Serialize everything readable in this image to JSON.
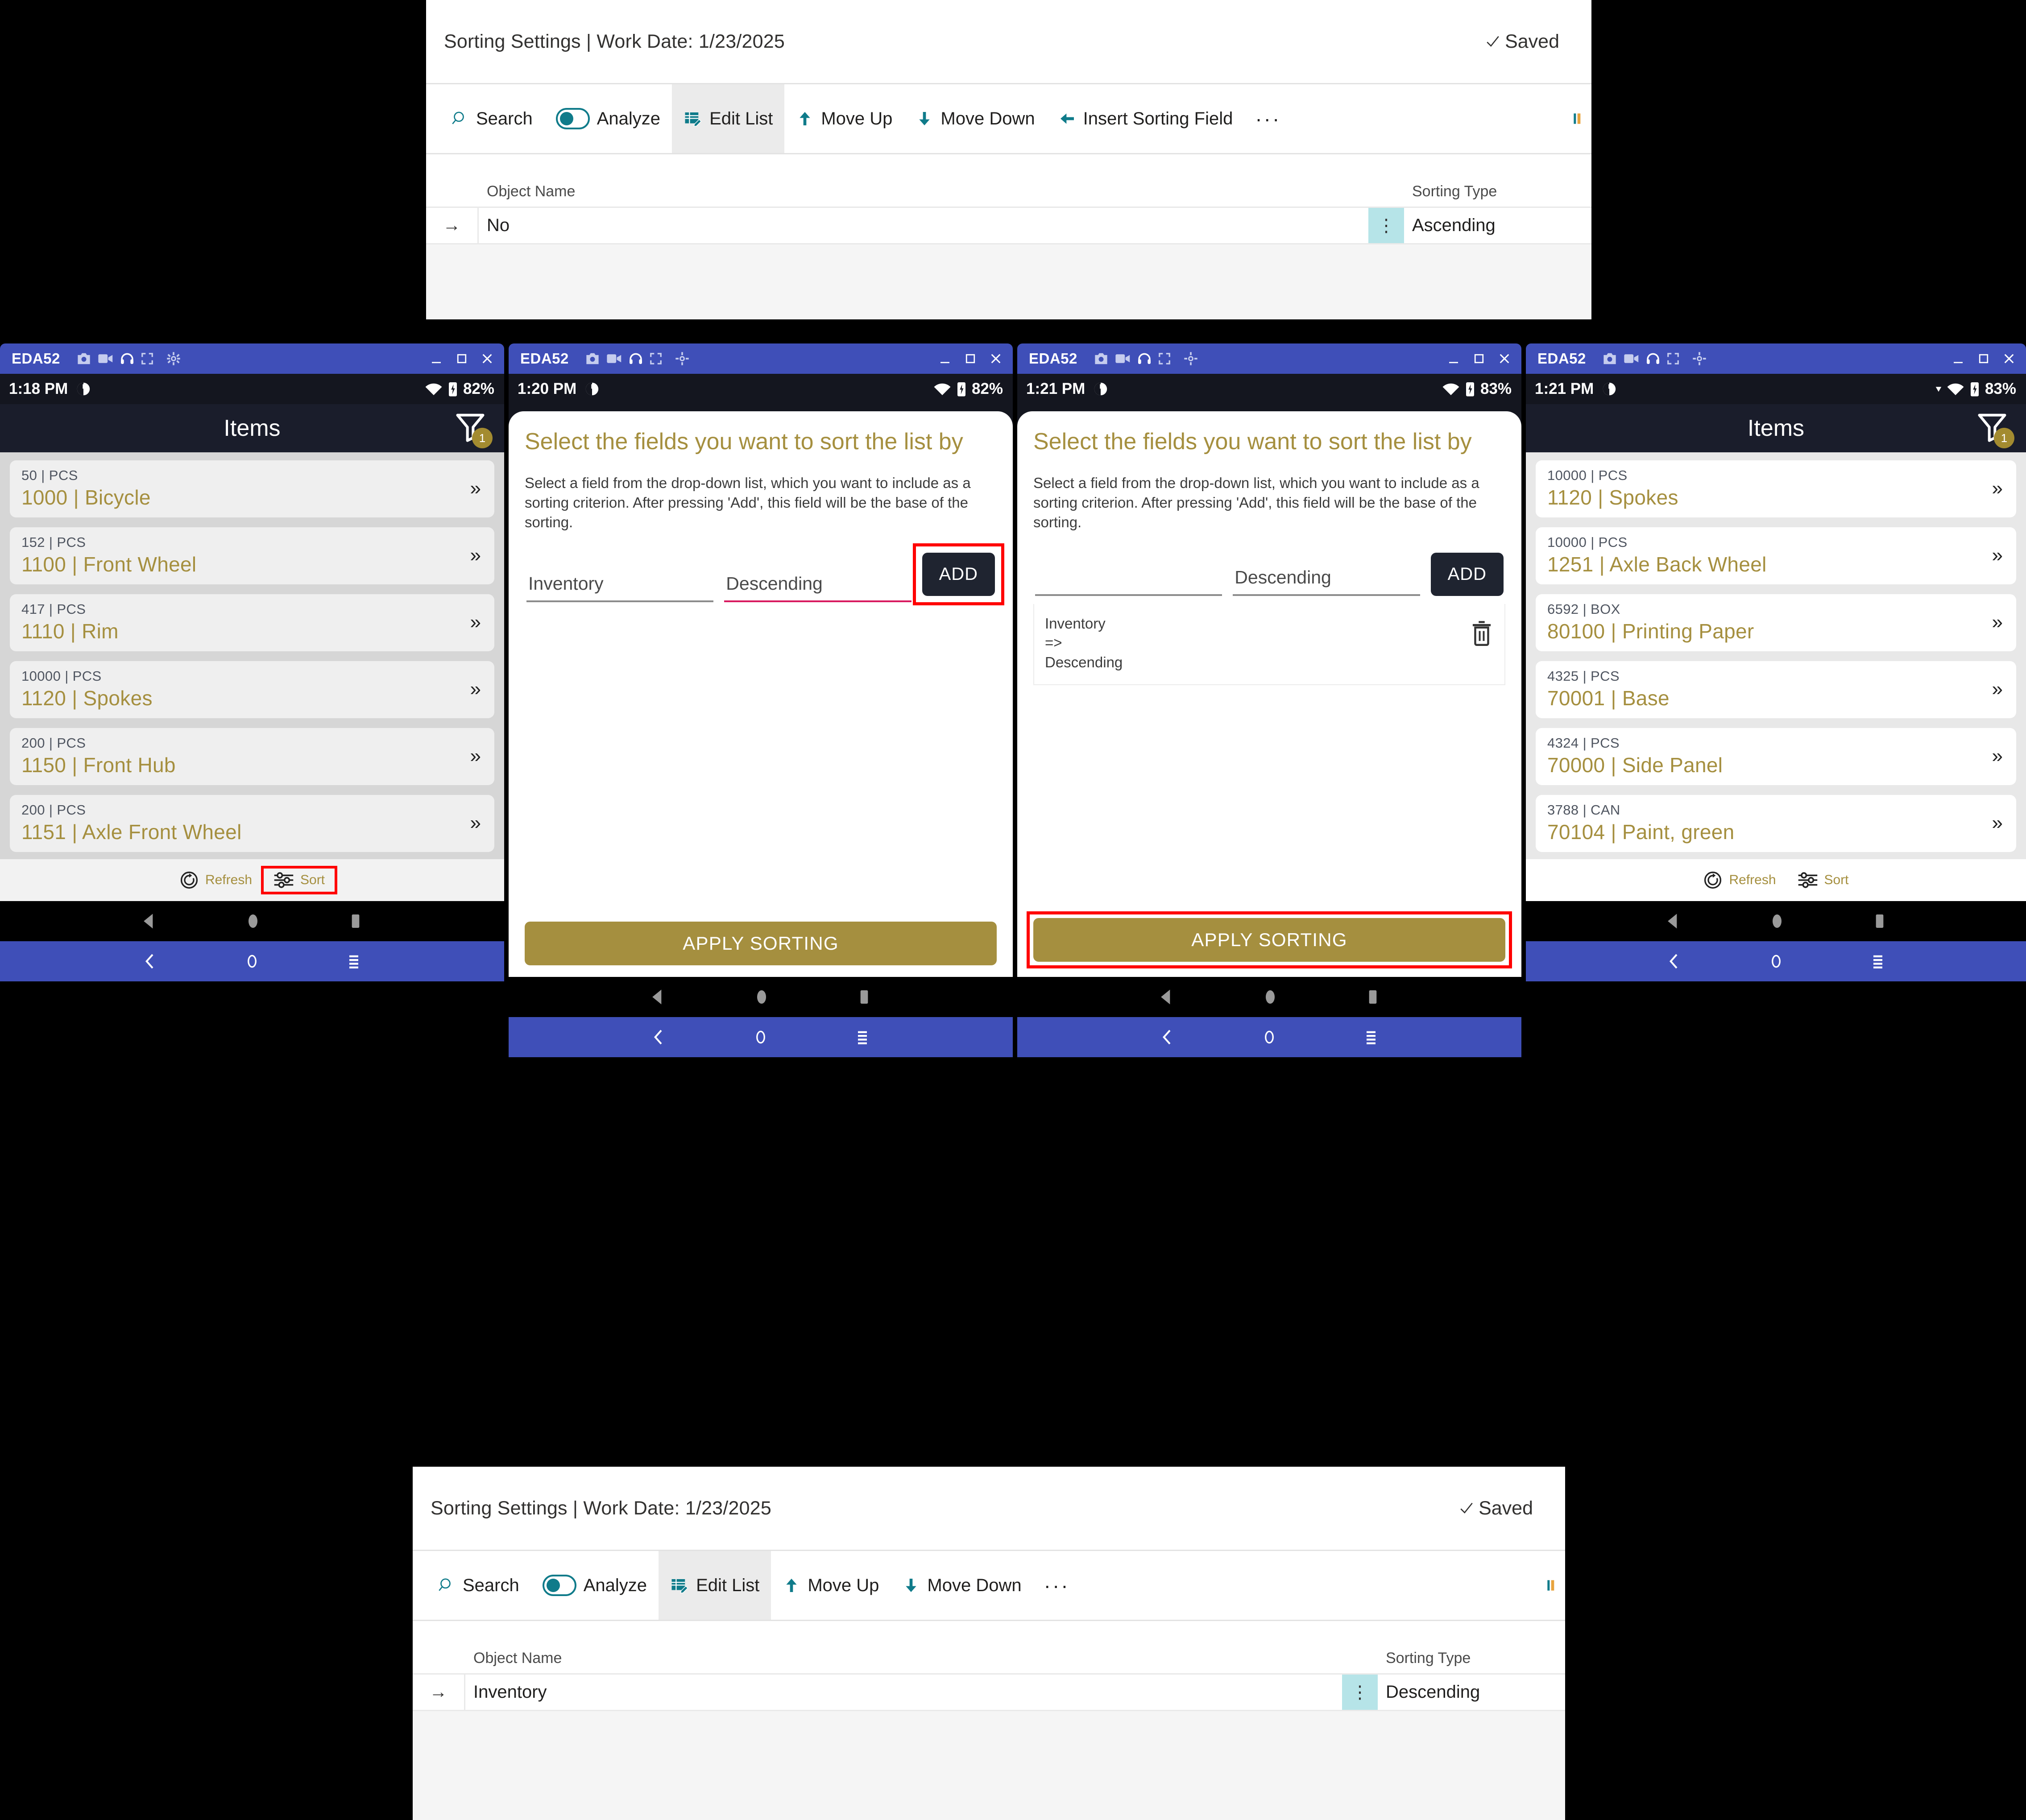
{
  "bc_top": {
    "title": "Sorting Settings | Work Date: 1/23/2025",
    "saved_label": "Saved",
    "ribbon": {
      "search": "Search",
      "analyze": "Analyze",
      "edit_list": "Edit List",
      "move_up": "Move Up",
      "move_down": "Move Down",
      "insert_sorting_field": "Insert Sorting Field",
      "overflow": "···"
    },
    "columns": {
      "object_name": "Object Name",
      "sorting_type": "Sorting Type"
    },
    "row": {
      "object_name": "No",
      "sorting_type": "Ascending",
      "row_arrow": "→"
    }
  },
  "bc_bottom": {
    "title": "Sorting Settings | Work Date: 1/23/2025",
    "saved_label": "Saved",
    "ribbon": {
      "search": "Search",
      "analyze": "Analyze",
      "edit_list": "Edit List",
      "move_up": "Move Up",
      "move_down": "Move Down",
      "overflow": "···"
    },
    "columns": {
      "object_name": "Object Name",
      "sorting_type": "Sorting Type"
    },
    "row": {
      "object_name": "Inventory",
      "sorting_type": "Descending",
      "row_arrow": "→"
    }
  },
  "colors": {
    "window_blue": "#3f4fb8",
    "status_dark": "#14161f",
    "gold": "#a58f3f",
    "teal": "#0f7b8a",
    "highlight_red": "#ff0000",
    "dots_cell": "#b6e4e8",
    "add_button": "#1f2430",
    "active_underline": "#d81b60"
  },
  "phones": [
    {
      "window": {
        "app_name": "EDA52"
      },
      "status": {
        "time": "1:18 PM",
        "battery": "82%"
      },
      "app_header": {
        "title": "Items",
        "filter_badge": "1"
      },
      "items": [
        {
          "qty": "50 | PCS",
          "name": "1000 | Bicycle"
        },
        {
          "qty": "152 | PCS",
          "name": "1100 | Front Wheel"
        },
        {
          "qty": "417 | PCS",
          "name": "1110 | Rim"
        },
        {
          "qty": "10000 | PCS",
          "name": "1120 | Spokes"
        },
        {
          "qty": "200 | PCS",
          "name": "1150 | Front Hub"
        },
        {
          "qty": "200 | PCS",
          "name": "1151 | Axle Front Wheel"
        }
      ],
      "actions": {
        "refresh": "Refresh",
        "sort": "Sort"
      }
    },
    {
      "window": {
        "app_name": "EDA52"
      },
      "status": {
        "time": "1:20 PM",
        "battery": "82%"
      },
      "sheet": {
        "title": "Select the fields you want to sort the list by",
        "description": "Select a field from the drop-down list, which you want to include as a sorting criterion. After pressing 'Add', this field will be the base of the sorting.",
        "field_value": "Inventory",
        "direction_value": "Descending",
        "add_label": "ADD",
        "apply_label": "APPLY SORTING"
      }
    },
    {
      "window": {
        "app_name": "EDA52"
      },
      "status": {
        "time": "1:21 PM",
        "battery": "83%"
      },
      "sheet": {
        "title": "Select the fields you want to sort the list by",
        "description": "Select a field from the drop-down list, which you want to include as a sorting criterion. After pressing 'Add', this field will be the base of the sorting.",
        "field_value": "",
        "direction_value": "Descending",
        "add_label": "ADD",
        "criterion": "Inventory\n=>\nDescending",
        "apply_label": "APPLY SORTING"
      }
    },
    {
      "window": {
        "app_name": "EDA52"
      },
      "status": {
        "time": "1:21 PM",
        "battery": "83%"
      },
      "app_header": {
        "title": "Items",
        "filter_badge": "1"
      },
      "items": [
        {
          "qty": "10000 | PCS",
          "name": "1120 | Spokes"
        },
        {
          "qty": "10000 | PCS",
          "name": "1251 | Axle Back Wheel"
        },
        {
          "qty": "6592 | BOX",
          "name": "80100 | Printing Paper"
        },
        {
          "qty": "4325 | PCS",
          "name": "70001 | Base"
        },
        {
          "qty": "4324 | PCS",
          "name": "70000 | Side Panel"
        },
        {
          "qty": "3788 | CAN",
          "name": "70104 | Paint, green"
        }
      ],
      "actions": {
        "refresh": "Refresh",
        "sort": "Sort"
      }
    }
  ]
}
